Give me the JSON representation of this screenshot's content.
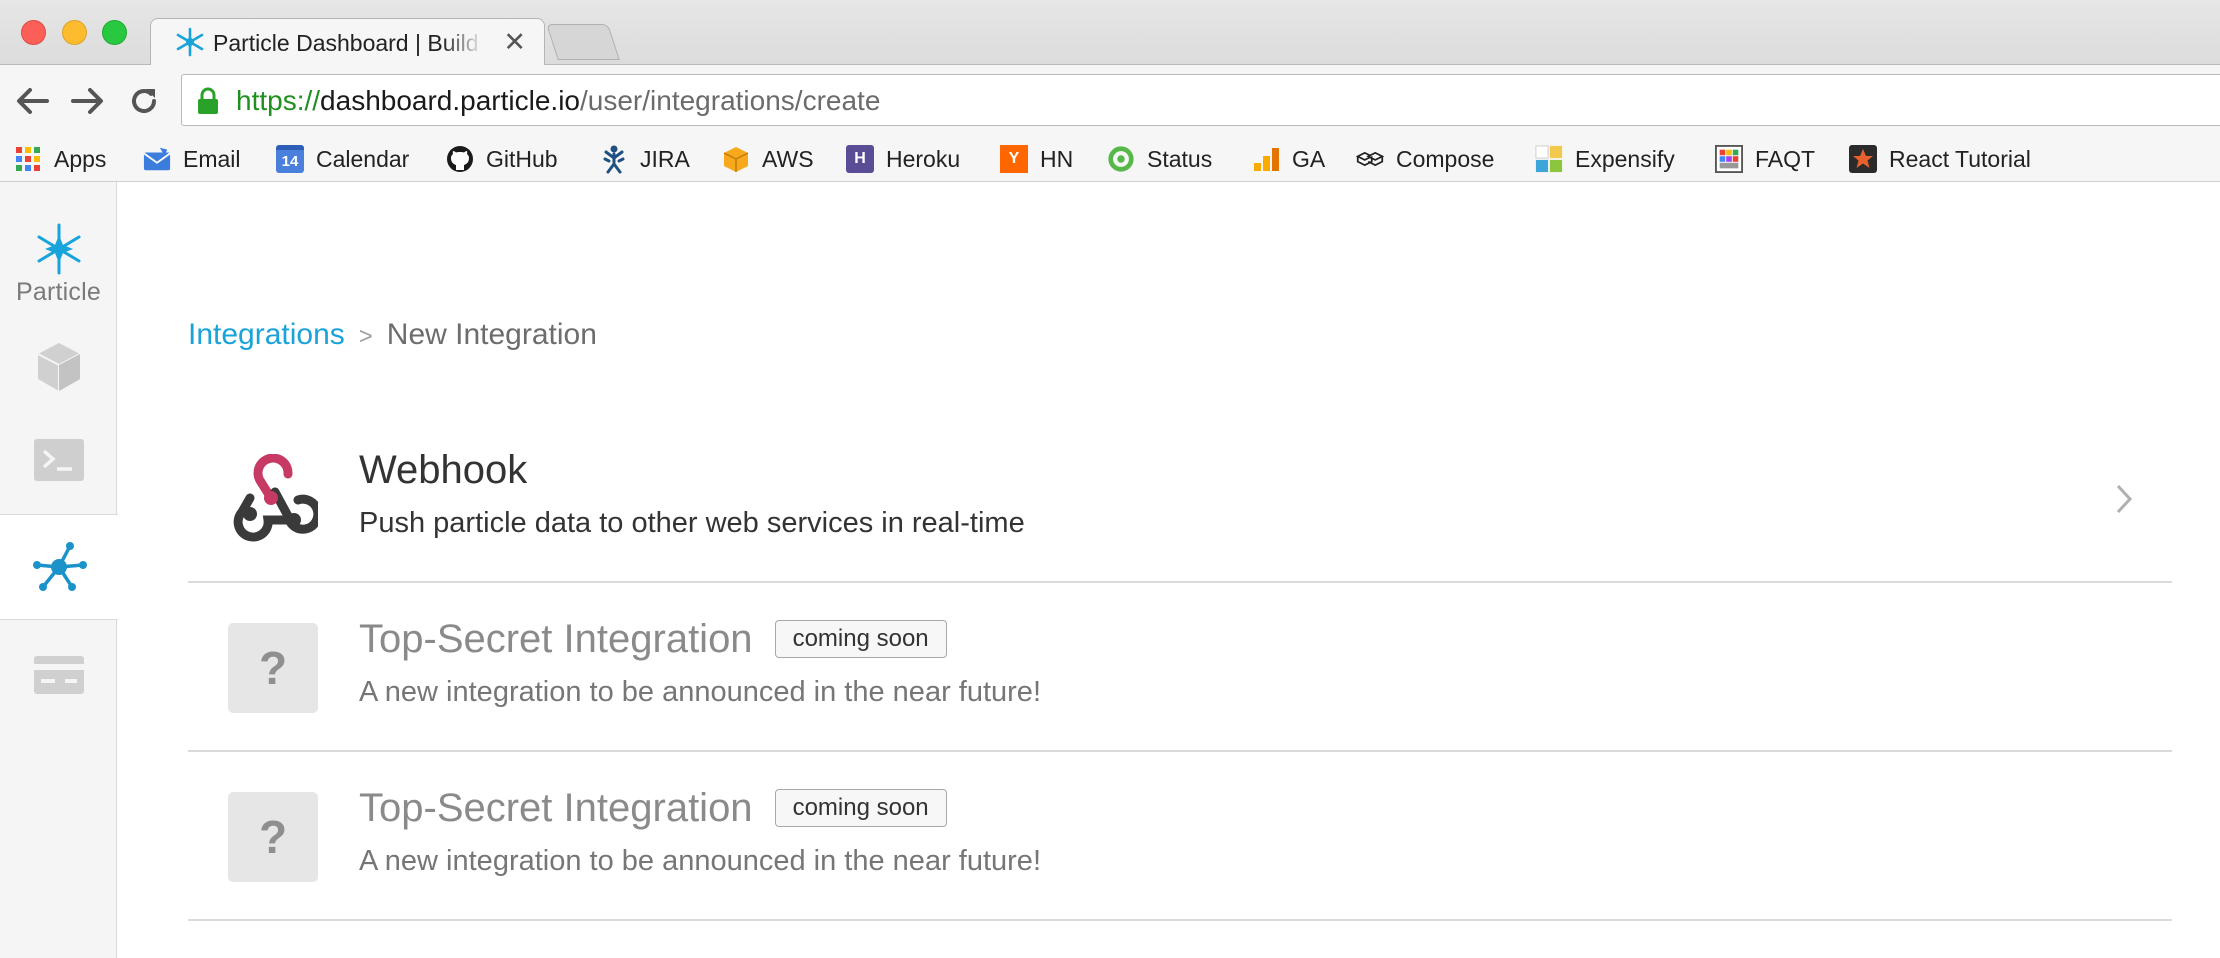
{
  "browser": {
    "tab": {
      "title": "Particle Dashboard | Build y",
      "close_glyph": "✕"
    },
    "url": {
      "scheme": "https://",
      "host": "dashboard.particle.io",
      "path": "/user/integrations/create"
    },
    "bookmarks": [
      {
        "label": "Apps",
        "icon": "apps-grid-icon"
      },
      {
        "label": "Email",
        "icon": "email-icon"
      },
      {
        "label": "Calendar",
        "icon": "calendar-icon",
        "icon_text": "14"
      },
      {
        "label": "GitHub",
        "icon": "github-icon"
      },
      {
        "label": "JIRA",
        "icon": "jira-icon"
      },
      {
        "label": "AWS",
        "icon": "aws-icon"
      },
      {
        "label": "Heroku",
        "icon": "heroku-icon",
        "icon_text": "H"
      },
      {
        "label": "HN",
        "icon": "hacker-news-icon",
        "icon_text": "Y"
      },
      {
        "label": "Status",
        "icon": "status-icon"
      },
      {
        "label": "GA",
        "icon": "google-analytics-icon"
      },
      {
        "label": "Compose",
        "icon": "compose-icon"
      },
      {
        "label": "Expensify",
        "icon": "expensify-icon"
      },
      {
        "label": "FAQT",
        "icon": "faqt-icon"
      },
      {
        "label": "React Tutorial",
        "icon": "react-tutorial-icon"
      }
    ]
  },
  "sidebar": {
    "logo_text": "Particle",
    "items": [
      {
        "name": "devices",
        "icon": "cube-icon"
      },
      {
        "name": "console",
        "icon": "terminal-icon"
      },
      {
        "name": "integrations",
        "icon": "network-icon",
        "active": true
      },
      {
        "name": "billing",
        "icon": "credit-card-icon"
      }
    ]
  },
  "breadcrumb": {
    "parent": "Integrations",
    "separator": ">",
    "current": "New Integration"
  },
  "integrations": [
    {
      "title": "Webhook",
      "description": "Push particle data to other web services in real-time",
      "icon": "webhook-icon",
      "badge": ""
    },
    {
      "title": "Top-Secret Integration",
      "description": "A new integration to be announced in the near future!",
      "icon": "question-mark-icon",
      "icon_text": "?",
      "badge": "coming soon"
    },
    {
      "title": "Top-Secret Integration",
      "description": "A new integration to be announced in the near future!",
      "icon": "question-mark-icon",
      "icon_text": "?",
      "badge": "coming soon"
    }
  ],
  "colors": {
    "accent": "#1aa3d9",
    "webhook_pink": "#c73a63",
    "webhook_dark": "#3a3a3a"
  }
}
